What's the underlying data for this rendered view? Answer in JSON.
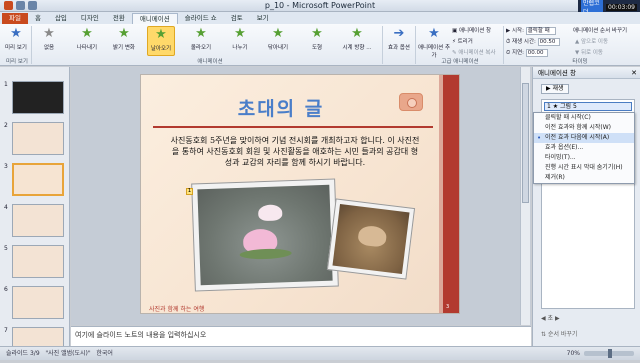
{
  "window": {
    "title": "p_10 - Microsoft PowerPoint"
  },
  "tray": {
    "brand": "만렙코더",
    "time": "00:03:09"
  },
  "tabs": [
    "파일",
    "홈",
    "삽입",
    "디자인",
    "전환",
    "애니메이션",
    "슬라이드 쇼",
    "검토",
    "보기"
  ],
  "ribbon": {
    "preview_label": "미리 보기",
    "effects": [
      "없음",
      "나타내기",
      "밝기 변화",
      "날아오기",
      "올라오기",
      "나누기",
      "닦아내기",
      "도형",
      "시계 방향 ..."
    ],
    "effect_options": "효과 옵션",
    "add_animation": "애니메이션 추가",
    "anim_pane": "애니메이션 창",
    "trigger": "트리거",
    "anim_painter": "애니메이션 복사",
    "start_label": "시작:",
    "start_value": "클릭할 때",
    "duration_label": "재생 시간:",
    "duration_value": "00.50",
    "delay_label": "지연:",
    "delay_value": "00.00",
    "reorder_title": "애니메이션 순서 바꾸기",
    "move_earlier": "앞으로 이동",
    "move_later": "뒤로 이동",
    "groups": {
      "preview": "미리 보기",
      "animation": "애니메이션",
      "advanced": "고급 애니메이션",
      "timing": "타이밍"
    }
  },
  "slide": {
    "title": "초대의 글",
    "body": "사진동호회 5주년을 맞이하여 기념 전시회를 개최하고자 합니다. 이 사진전을 통하여 사진동호회 회원 및 사진활동을 애호하는 시민 들과의 공감대 형성과 교감의 자리를 함께 하시기 바랍니다.",
    "marker": "1",
    "footer": "사진과 함께 하는 여행",
    "page": "3"
  },
  "notes": {
    "placeholder": "여기에 슬라이드 노트의 내용을 입력하십시오"
  },
  "anim_pane": {
    "title": "애니메이션 창",
    "play": "재생",
    "item": "1 ★ 그림 5",
    "menu": [
      {
        "label": "클릭할 때 시작(C)",
        "checked": false
      },
      {
        "label": "이전 효과와 함께 시작(W)",
        "checked": false
      },
      {
        "label": "이전 효과 다음에 시작(A)",
        "checked": true
      },
      {
        "label": "효과 옵션(E)...",
        "checked": false
      },
      {
        "label": "타이밍(T)...",
        "checked": false
      },
      {
        "label": "진행 시간 표시 막대 숨기기(H)",
        "checked": false
      },
      {
        "label": "제거(R)",
        "checked": false
      }
    ],
    "seconds": "초",
    "reorder": "순서 바꾸기"
  },
  "status": {
    "slide": "슬라이드 3/9",
    "theme": "\"사진 앨범(도시)\"",
    "lang": "한국어",
    "zoom": "70%"
  },
  "colors": {
    "accent": "#c94a1e",
    "slide_bar": "#b23a2f",
    "title": "#4a7ec9",
    "selected_effect": "#ffd96a"
  }
}
